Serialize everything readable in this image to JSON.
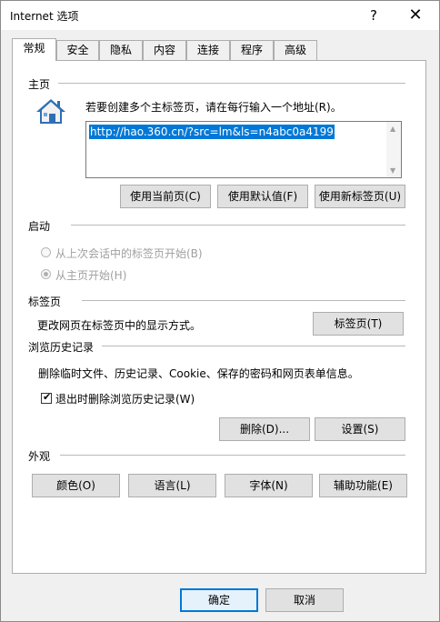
{
  "window": {
    "title": "Internet 选项",
    "help_glyph": "?",
    "close_glyph": "✕"
  },
  "tabs": [
    {
      "label": "常规",
      "active": true
    },
    {
      "label": "安全"
    },
    {
      "label": "隐私"
    },
    {
      "label": "内容"
    },
    {
      "label": "连接"
    },
    {
      "label": "程序"
    },
    {
      "label": "高级"
    }
  ],
  "home": {
    "section_title": "主页",
    "instruction": "若要创建多个主标签页，请在每行输入一个地址(R)。",
    "url": "http://hao.360.cn/?src=lm&ls=n4abc0a4199",
    "btn_current": "使用当前页(C)",
    "btn_default": "使用默认值(F)",
    "btn_newtab": "使用新标签页(U)"
  },
  "startup": {
    "section_title": "启动",
    "option_last": "从上次会话中的标签页开始(B)",
    "option_home": "从主页开始(H)"
  },
  "tabs_section": {
    "section_title": "标签页",
    "description": "更改网页在标签页中的显示方式。",
    "btn": "标签页(T)"
  },
  "history": {
    "section_title": "浏览历史记录",
    "description": "删除临时文件、历史记录、Cookie、保存的密码和网页表单信息。",
    "checkbox_label": "退出时删除浏览历史记录(W)",
    "btn_delete": "删除(D)...",
    "btn_settings": "设置(S)"
  },
  "appearance": {
    "section_title": "外观",
    "btn_colors": "颜色(O)",
    "btn_language": "语言(L)",
    "btn_fonts": "字体(N)",
    "btn_accessibility": "辅助功能(E)"
  },
  "footer": {
    "ok": "确定",
    "cancel": "取消"
  },
  "colors": {
    "accent": "#0078d7"
  }
}
